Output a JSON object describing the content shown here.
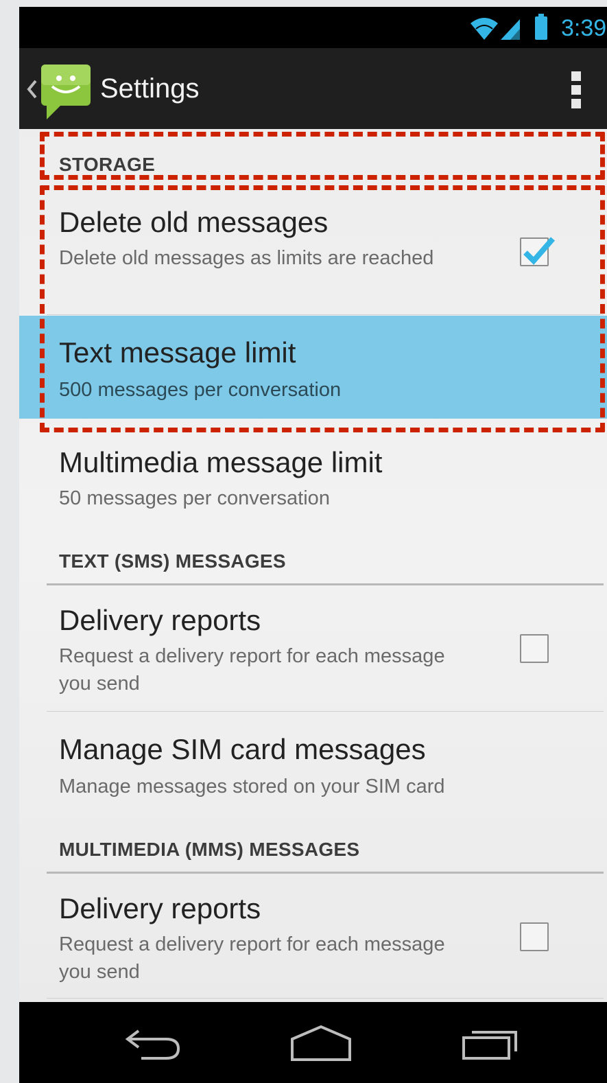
{
  "status_bar": {
    "time": "3:39",
    "icons": [
      "wifi-icon",
      "signal-icon",
      "battery-icon"
    ],
    "accent": "#33b5e5"
  },
  "action_bar": {
    "title": "Settings",
    "app_icon": "messaging-app-icon",
    "overflow_icon": "overflow-menu-icon"
  },
  "sections": {
    "storage": {
      "header": "STORAGE",
      "delete_old": {
        "title": "Delete old messages",
        "summary": "Delete old messages as limits are reached",
        "checked": true
      },
      "text_limit": {
        "title": "Text message limit",
        "summary": "500 messages per conversation",
        "selected": true
      },
      "mms_limit": {
        "title": "Multimedia message limit",
        "summary": "50 messages per conversation"
      }
    },
    "sms": {
      "header": "TEXT (SMS) MESSAGES",
      "delivery_reports": {
        "title": "Delivery reports",
        "summary": "Request a delivery report for each message you send",
        "checked": false
      },
      "manage_sim": {
        "title": "Manage SIM card messages",
        "summary": "Manage messages stored on your SIM card"
      }
    },
    "mms": {
      "header": "MULTIMEDIA (MMS) MESSAGES",
      "delivery_reports": {
        "title": "Delivery reports",
        "summary": "Request a delivery report for each message you send",
        "checked": false
      }
    }
  },
  "nav_bar": {
    "icons": [
      "back-icon",
      "home-icon",
      "recents-icon"
    ]
  },
  "colors": {
    "selected_row": "#7ec9e8",
    "annotation": "#cc2200",
    "checkmark": "#33b5e5"
  }
}
